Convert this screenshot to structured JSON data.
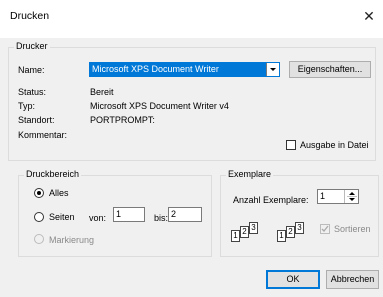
{
  "window": {
    "title": "Drucken",
    "close_glyph": "✕"
  },
  "printer": {
    "group_label": "Drucker",
    "name_label": "Name:",
    "name_value": "Microsoft XPS Document Writer",
    "properties_button": "Eigenschaften...",
    "status_label": "Status:",
    "status_value": "Bereit",
    "type_label": "Typ:",
    "type_value": "Microsoft XPS Document Writer v4",
    "location_label": "Standort:",
    "location_value": "PORTPROMPT:",
    "comment_label": "Kommentar:",
    "print_to_file_label": "Ausgabe in Datei"
  },
  "range": {
    "group_label": "Druckbereich",
    "all_label": "Alles",
    "pages_label": "Seiten",
    "from_label": "von:",
    "from_value": "1",
    "to_label": "bis:",
    "to_value": "2",
    "selection_label": "Markierung"
  },
  "copies": {
    "group_label": "Exemplare",
    "count_label": "Anzahl Exemplare:",
    "count_value": "1",
    "collate_label": "Sortieren",
    "page_digits": [
      "1",
      "2",
      "3"
    ]
  },
  "buttons": {
    "ok": "OK",
    "cancel": "Abbrechen"
  }
}
